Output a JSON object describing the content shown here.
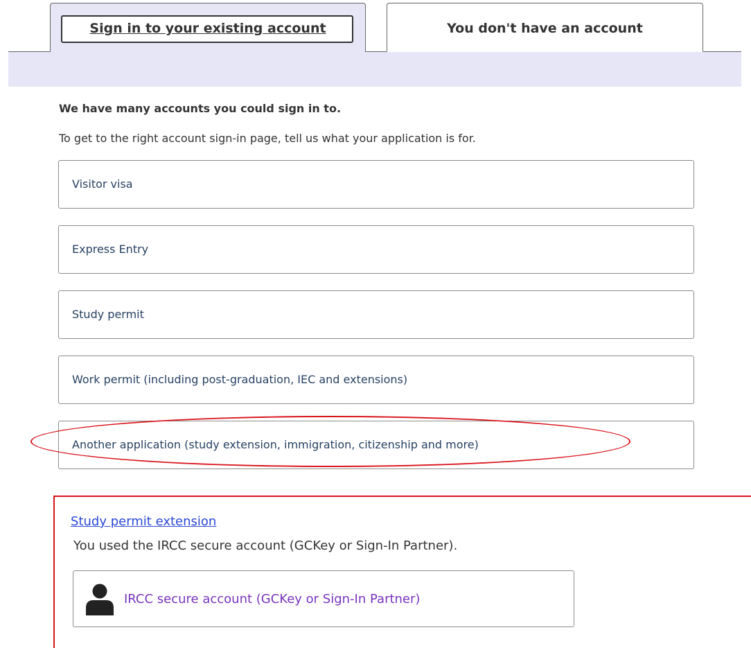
{
  "tabs": {
    "sign_in_label": "Sign in to your existing account",
    "no_account_label": "You don't have an account"
  },
  "intro": {
    "heading": "We have many accounts you could sign in to.",
    "text": "To get to the right account sign-in page, tell us what your application is for."
  },
  "options": [
    {
      "label": "Visitor visa"
    },
    {
      "label": "Express Entry"
    },
    {
      "label": "Study permit"
    },
    {
      "label": "Work permit (including post-graduation, IEC and extensions)"
    },
    {
      "label": "Another application (study extension, immigration, citizenship and more)"
    }
  ],
  "result": {
    "link_label": "Study permit extension",
    "description": "You used the IRCC secure account (GCKey or Sign-In Partner).",
    "account_button_label": "IRCC secure account (GCKey or Sign-In Partner)",
    "account_icon": "person-icon"
  },
  "colors": {
    "tab_bar_bg": "#e6e6f7",
    "option_text": "#284162",
    "link": "#2b48d6",
    "account_label": "#7834bc",
    "annotation_red": "#d9121a"
  }
}
